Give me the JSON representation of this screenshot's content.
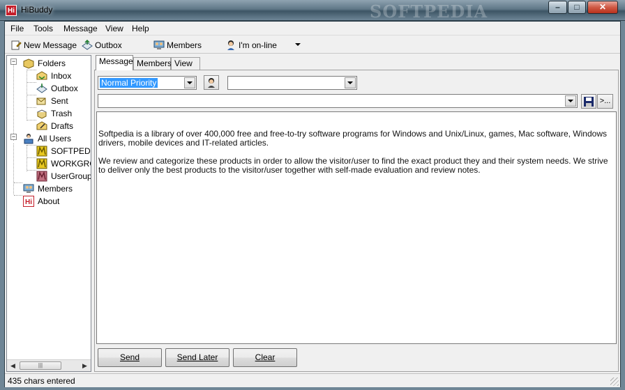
{
  "window": {
    "title": "HiBuddy",
    "app_icon_text": "Hi",
    "watermark": "SOFTPEDIA",
    "controls": {
      "minimize": "–",
      "maximize": "□",
      "close": "✕"
    }
  },
  "menu": [
    "File",
    "Tools",
    "Message",
    "View",
    "Help"
  ],
  "toolbar": {
    "new_message": "New Message",
    "outbox": "Outbox",
    "members": "Members",
    "status": "I'm on-line"
  },
  "tree": {
    "folders": "Folders",
    "inbox": "Inbox",
    "outbox": "Outbox",
    "sent": "Sent",
    "trash": "Trash",
    "drafts": "Drafts",
    "all_users": "All Users",
    "softpedia": "SOFTPEDIA",
    "workgroup": "WORKGROUP",
    "usergroup": "UserGroup",
    "members": "Members",
    "about": "About",
    "scroll_thumb": "|||"
  },
  "tabs": [
    "Message",
    "Members",
    "View"
  ],
  "compose": {
    "priority": "Normal Priority",
    "recipient_combo": "",
    "subject_combo": "",
    "browse_button": ">...",
    "body_paragraphs": [
      "Softpedia is a library of over 400,000 free and free-to-try software programs for Windows and Unix/Linux, games, Mac software, Windows drivers, mobile devices and IT-related articles.",
      "We review and categorize these products in order to allow the visitor/user to find the exact product they and their system needs. We strive to deliver only the best products to the visitor/user together with self-made evaluation and review notes."
    ]
  },
  "actions": {
    "send": "Send",
    "send_later": "Send Later",
    "clear": "Clear"
  },
  "status": {
    "chars": "435  chars entered"
  },
  "colors": {
    "accent_red": "#c41e2a",
    "selection_blue": "#3399ff"
  }
}
